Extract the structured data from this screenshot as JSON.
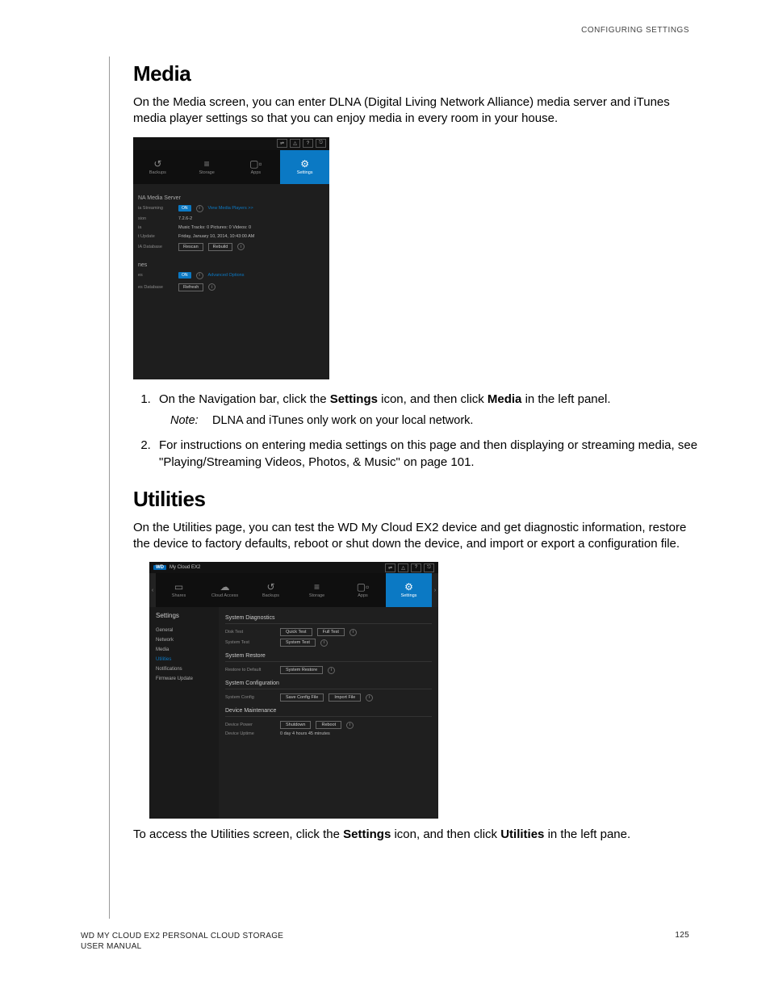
{
  "header": {
    "section": "CONFIGURING SETTINGS"
  },
  "media": {
    "heading": "Media",
    "intro": "On the Media screen, you can enter DLNA (Digital Living Network Alliance) media server and iTunes media player settings so that you can enjoy media in every room in your house.",
    "step1_pre": "On the Navigation bar, click the ",
    "step1_b1": "Settings",
    "step1_mid": " icon, and then click ",
    "step1_b2": "Media",
    "step1_post": " in the left panel.",
    "note_label": "Note:",
    "note_text": "DLNA and iTunes only work on your local network.",
    "step2": "For instructions on entering media settings on this page and then displaying or streaming media, see \"Playing/Streaming Videos, Photos, & Music\" on page 101."
  },
  "utilities": {
    "heading": "Utilities",
    "intro": "On the Utilities page, you can test the WD My Cloud EX2 device and get diagnostic information, restore the device to factory defaults, reboot or shut down the device, and import or export a configuration file.",
    "closing_pre": "To access the Utilities screen, click the ",
    "closing_b1": "Settings",
    "closing_mid": " icon, and then click ",
    "closing_b2": "Utilities",
    "closing_post": " in the left pane."
  },
  "footer": {
    "left1": "WD MY CLOUD EX2 PERSONAL CLOUD STORAGE",
    "left2": "USER MANUAL",
    "pagenum": "125"
  },
  "ss1": {
    "nav": {
      "backups": "Backups",
      "storage": "Storage",
      "apps": "Apps",
      "settings": "Settings"
    },
    "section1": "NA Media Server",
    "streaming_lbl": "ia Streaming",
    "on": "ON",
    "viewplayers": "View Media Players >>",
    "ver_lbl": "sion",
    "ver_val": "7.2.6-2",
    "media_lbl": "ia",
    "media_val": "Music Tracks: 0    Pictures: 0    Videos: 0",
    "upd_lbl": "t Update",
    "upd_val": "Friday, January 10, 2014, 10:43:00 AM",
    "db_lbl": "IA Database",
    "rescan": "Rescan",
    "rebuild": "Rebuild",
    "section2": "nes",
    "itunes_lbl": "es",
    "adv": "Advanced Options",
    "refresh_lbl": "es Database",
    "refresh": "Refresh"
  },
  "ss2": {
    "brand": "WD",
    "title": "My Cloud EX2",
    "nav": {
      "shares": "Shares",
      "cloud": "Cloud Access",
      "backups": "Backups",
      "storage": "Storage",
      "apps": "Apps",
      "settings": "Settings"
    },
    "settings_hdr": "Settings",
    "side": {
      "general": "General",
      "network": "Network",
      "media": "Media",
      "utilities": "Utilities",
      "notifications": "Notifications",
      "firmware": "Firmware Update"
    },
    "diag": {
      "title": "System Diagnostics",
      "disk_lbl": "Disk Test",
      "quick": "Quick Test",
      "full": "Full Test",
      "sys_lbl": "System Test",
      "sys_btn": "System Test"
    },
    "restore": {
      "title": "System Restore",
      "lbl": "Restore to Default",
      "btn": "System Restore"
    },
    "config": {
      "title": "System Configuration",
      "lbl": "System Config",
      "save": "Save Config File",
      "import": "Import File"
    },
    "maint": {
      "title": "Device Maintenance",
      "power_lbl": "Device Power",
      "shutdown": "Shutdown",
      "reboot": "Reboot",
      "uptime_lbl": "Device Uptime",
      "uptime_val": "0 day 4 hours 45 minutes"
    }
  }
}
